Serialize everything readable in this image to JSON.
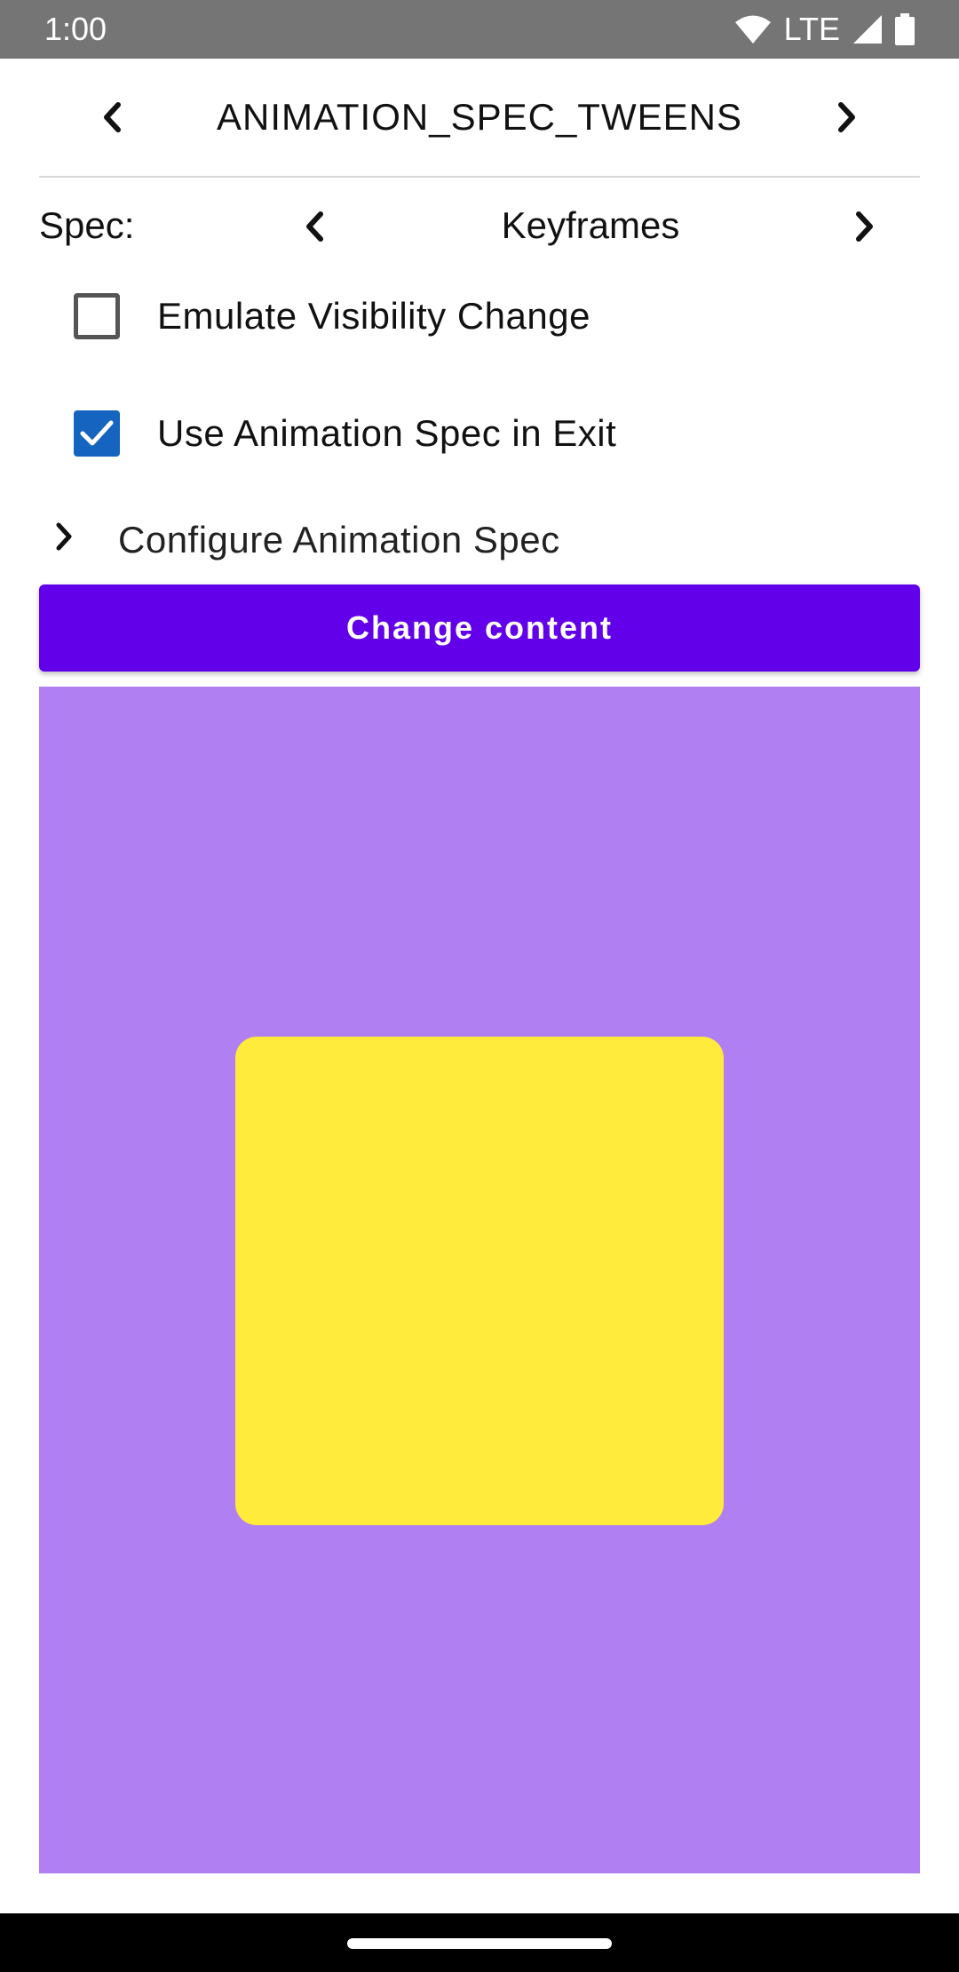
{
  "status_bar": {
    "time": "1:00",
    "network": "LTE",
    "icons": [
      "wifi-icon",
      "signal-icon",
      "battery-icon"
    ]
  },
  "header": {
    "title": "ANIMATION_SPEC_TWEENS",
    "prev_icon": "chevron-left-icon",
    "next_icon": "chevron-right-icon"
  },
  "spec": {
    "label": "Spec:",
    "value": "Keyframes"
  },
  "options": [
    {
      "label": "Emulate Visibility Change",
      "checked": false
    },
    {
      "label": "Use Animation Spec in Exit",
      "checked": true
    }
  ],
  "configure": {
    "label": "Configure Animation Spec",
    "icon": "chevron-right-icon"
  },
  "change_button": {
    "label": "Change content"
  },
  "colors": {
    "accent_button": "#6200ea",
    "checkbox_checked": "#1565c0",
    "animation_background": "#b07ff2",
    "animation_box": "#ffeb3b"
  }
}
